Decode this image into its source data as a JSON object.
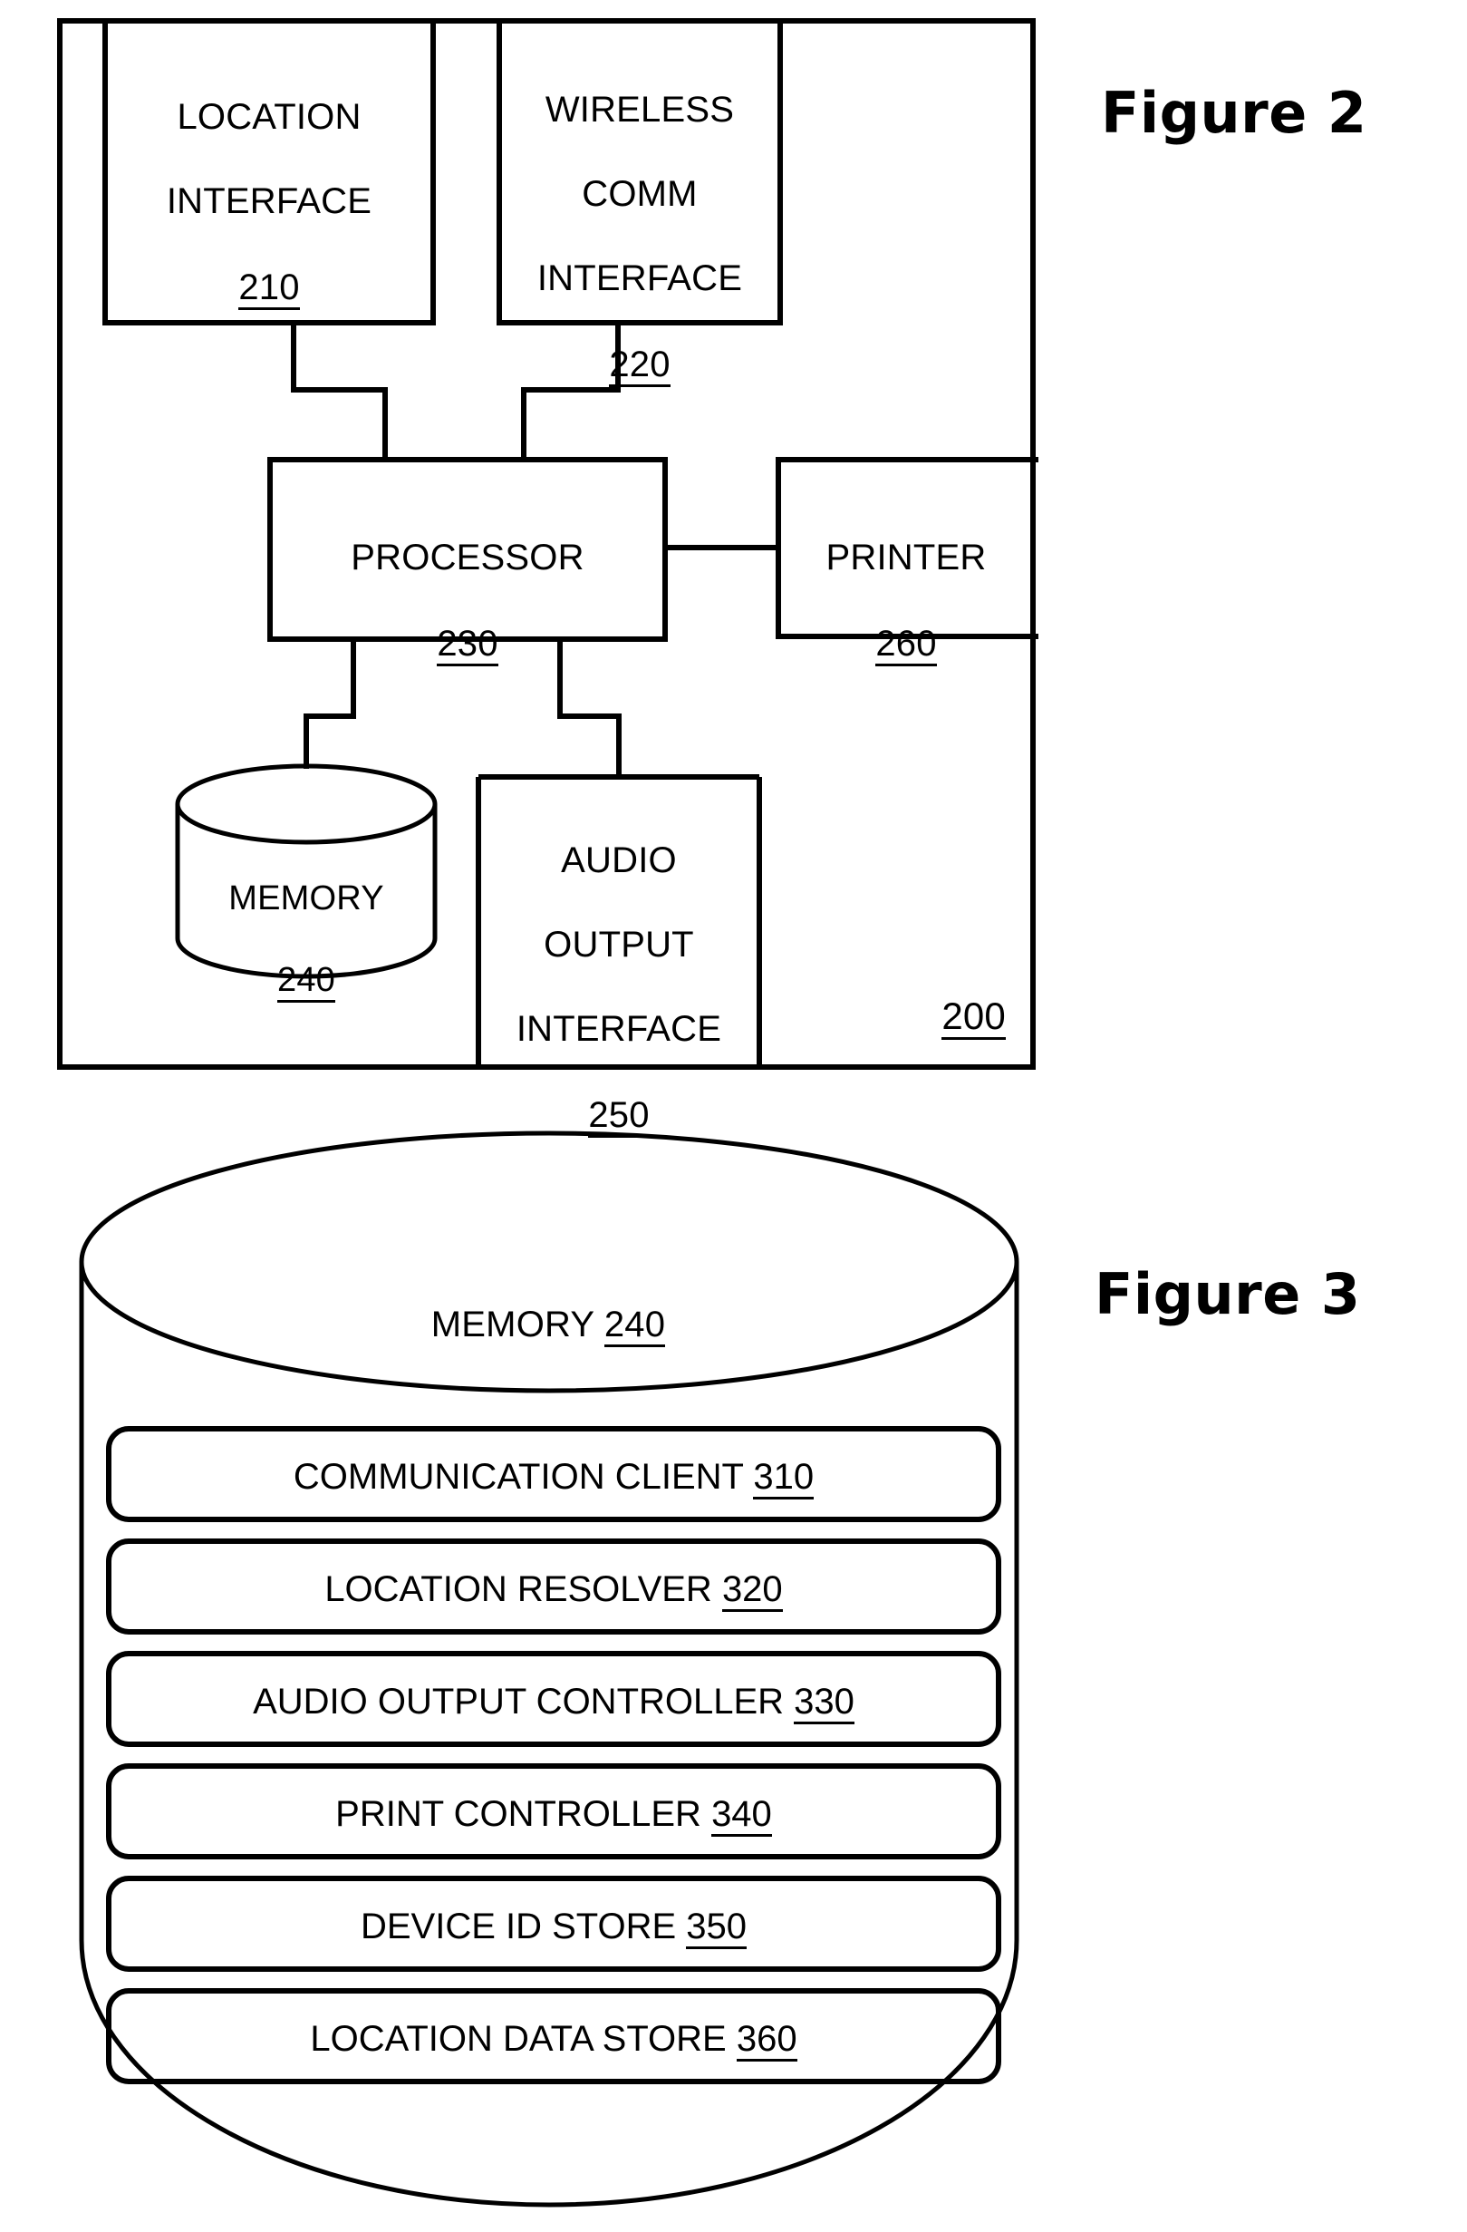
{
  "figure2": {
    "label": "Figure 2",
    "system_ref": "200",
    "nodes": [
      {
        "id": "location-interface",
        "lines": [
          "LOCATION",
          "INTERFACE"
        ],
        "ref": "210"
      },
      {
        "id": "wireless-comm-interface",
        "lines": [
          "WIRELESS",
          "COMM",
          "INTERFACE"
        ],
        "ref": "220"
      },
      {
        "id": "processor",
        "lines": [
          "PROCESSOR"
        ],
        "ref": "230"
      },
      {
        "id": "printer",
        "lines": [
          "PRINTER"
        ],
        "ref": "260"
      },
      {
        "id": "memory",
        "lines": [
          "MEMORY"
        ],
        "ref": "240"
      },
      {
        "id": "audio-output-interface",
        "lines": [
          "AUDIO",
          "OUTPUT",
          "INTERFACE"
        ],
        "ref": "250"
      }
    ],
    "text": {
      "location_interface_l1": "LOCATION",
      "location_interface_l2": "INTERFACE",
      "location_interface_ref": "210",
      "wireless_comm_l1": "WIRELESS",
      "wireless_comm_l2": "COMM",
      "wireless_comm_l3": "INTERFACE",
      "wireless_comm_ref": "220",
      "processor_l1": "PROCESSOR",
      "processor_ref": "230",
      "printer_l1": "PRINTER",
      "printer_ref": "260",
      "memory_l1": "MEMORY",
      "memory_ref": "240",
      "audio_output_l1": "AUDIO",
      "audio_output_l2": "OUTPUT",
      "audio_output_l3": "INTERFACE",
      "audio_output_ref": "250",
      "system_ref": "200"
    }
  },
  "figure3": {
    "label": "Figure 3",
    "cylinder_title": "MEMORY ",
    "cylinder_ref": "240",
    "items": [
      {
        "label": "COMMUNICATION CLIENT ",
        "ref": "310"
      },
      {
        "label": "LOCATION RESOLVER ",
        "ref": "320"
      },
      {
        "label": "AUDIO OUTPUT CONTROLLER ",
        "ref": "330"
      },
      {
        "label": "PRINT CONTROLLER ",
        "ref": "340"
      },
      {
        "label": "DEVICE ID STORE ",
        "ref": "350"
      },
      {
        "label": "LOCATION DATA STORE ",
        "ref": "360"
      }
    ]
  },
  "style": {
    "stroke": "#000000",
    "background": "#ffffff"
  }
}
